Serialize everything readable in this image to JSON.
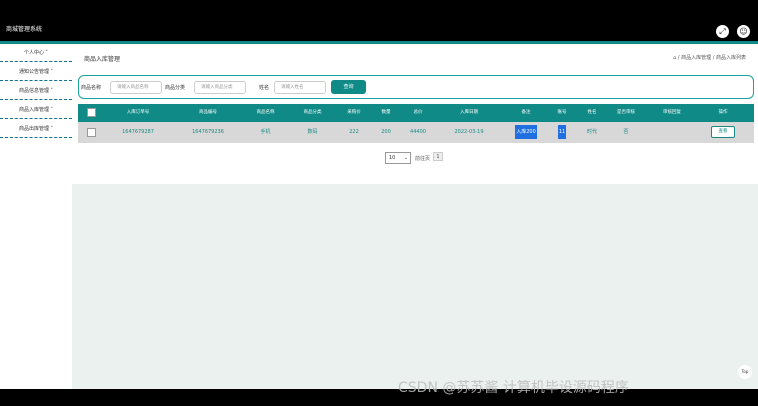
{
  "header": {
    "title": "商城管理系统",
    "icons": [
      "expand-icon",
      "user-icon"
    ]
  },
  "sidebar": {
    "items": [
      {
        "label": "个人中心 ˅"
      },
      {
        "label": "通知公告管理 ˅"
      },
      {
        "label": "商品信息管理 ˅"
      },
      {
        "label": "商品入库管理 ˅"
      },
      {
        "label": "商品出库管理 ˅"
      }
    ]
  },
  "page": {
    "title": "商品入库管理",
    "breadcrumb": "⌂ / 商品入库管理 / 商品入库列表"
  },
  "search": {
    "name_label": "商品名称",
    "name_placeholder": "请输入商品名称",
    "category_label": "商品分类",
    "category_placeholder": "请输入商品分类",
    "person_label": "姓名",
    "person_placeholder": "请输入姓名",
    "button": "查询"
  },
  "table": {
    "headers": [
      "入库订单号",
      "商品编号",
      "商品名称",
      "商品分类",
      "采购价",
      "数量",
      "总价",
      "入库日期",
      "备注",
      "账号",
      "姓名",
      "是否审核",
      "审核回复",
      "操作"
    ],
    "rows": [
      {
        "order_no": "1647679287",
        "product_no": "1647679236",
        "name": "手机",
        "category": "数码",
        "price": "222",
        "qty": "200",
        "total": "44400",
        "date": "2022-03-19",
        "note": "入库200",
        "account": "11",
        "person": "时代",
        "approved": "否",
        "reply": "",
        "action": "查看"
      }
    ]
  },
  "pager": {
    "page_size": "10",
    "goto_label": "前往页",
    "page": "1"
  },
  "misc": {
    "top_button": "Top",
    "watermark": "CSDN @苏苏酱      计算机毕设源码程序"
  }
}
